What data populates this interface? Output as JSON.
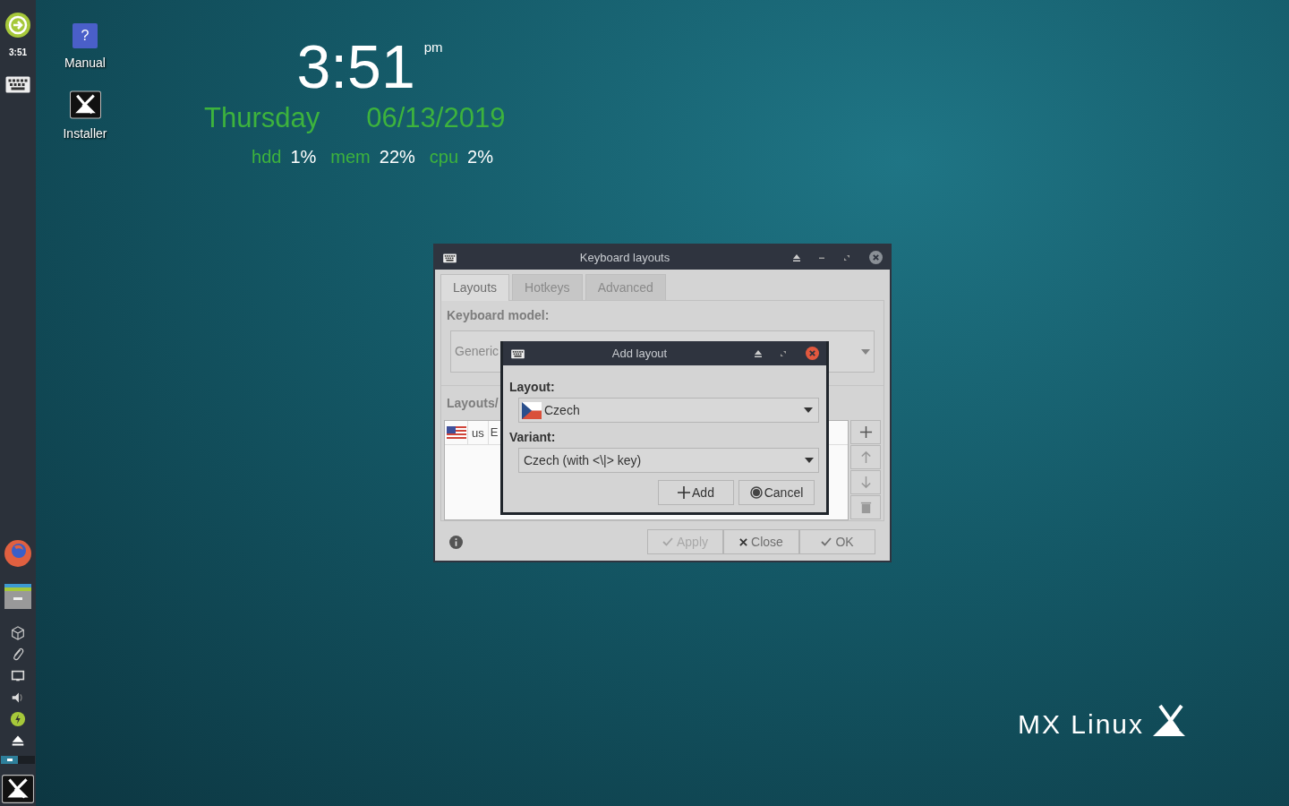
{
  "panel": {
    "clock": "3:51",
    "workspaces": [
      {
        "selected": true
      },
      {
        "selected": false
      }
    ]
  },
  "desktop_icons": [
    {
      "kind": "help",
      "label": "Manual",
      "glyph": "?"
    },
    {
      "kind": "installer",
      "label": "Installer"
    }
  ],
  "conky": {
    "time": "3:51",
    "meridiem": "pm",
    "day": "Thursday",
    "date": "06/13/2019",
    "stats": [
      {
        "label": "hdd",
        "value": "1%"
      },
      {
        "label": "mem",
        "value": "22%"
      },
      {
        "label": "cpu",
        "value": "2%"
      }
    ]
  },
  "keyboard_window": {
    "title": "Keyboard layouts",
    "tabs": [
      {
        "label": "Layouts",
        "selected": true
      },
      {
        "label": "Hotkeys",
        "selected": false
      },
      {
        "label": "Advanced",
        "selected": false
      }
    ],
    "keyboard_model_label": "Keyboard model:",
    "keyboard_model": "Generic",
    "layouts_label": "Layouts/",
    "layouts": [
      {
        "layout": "us",
        "column_3": "E"
      }
    ],
    "buttons": [
      {
        "kind": "check",
        "label": "Apply",
        "disabled": true
      },
      {
        "kind": "cross",
        "label": "Close",
        "disabled": false
      },
      {
        "kind": "check",
        "label": "OK",
        "disabled": false
      }
    ]
  },
  "add_layout_dialog": {
    "title": "Add layout",
    "layout_label": "Layout:",
    "layout": "Czech",
    "variant_label": "Variant:",
    "variant": "Czech (with <\\|> key)",
    "buttons": [
      {
        "kind": "plus",
        "label": "Add"
      },
      {
        "kind": "cancel",
        "label": "Cancel"
      }
    ]
  },
  "logo": "MX Linux"
}
